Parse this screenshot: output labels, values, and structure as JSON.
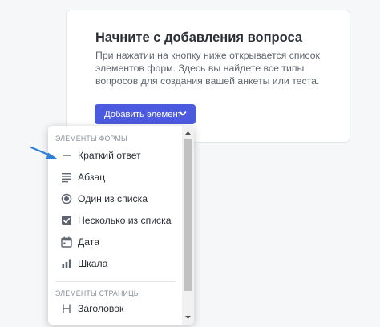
{
  "card": {
    "title": "Начните с добавления вопроса",
    "description": "При нажатии на кнопку ниже открывается список элементов форм. Здесь вы найдете все типы вопросов для создания вашей анкеты или теста.",
    "button_label": "Добавить элемент"
  },
  "dropdown": {
    "form_section_label": "ЭЛЕМЕНТЫ ФОРМЫ",
    "form_items": [
      {
        "label": "Краткий ответ",
        "icon": "short-answer-icon"
      },
      {
        "label": "Абзац",
        "icon": "paragraph-icon"
      },
      {
        "label": "Один из списка",
        "icon": "radio-icon"
      },
      {
        "label": "Несколько из списка",
        "icon": "checkbox-icon"
      },
      {
        "label": "Дата",
        "icon": "calendar-icon"
      },
      {
        "label": "Шкала",
        "icon": "scale-icon"
      }
    ],
    "page_section_label": "ЭЛЕМЕНТЫ СТРАНИЦЫ",
    "page_items": [
      {
        "label": "Заголовок",
        "icon": "heading-icon"
      }
    ]
  },
  "colors": {
    "accent": "#4c5ae0",
    "icon": "#5f6570",
    "arrow": "#2f7fd6"
  }
}
